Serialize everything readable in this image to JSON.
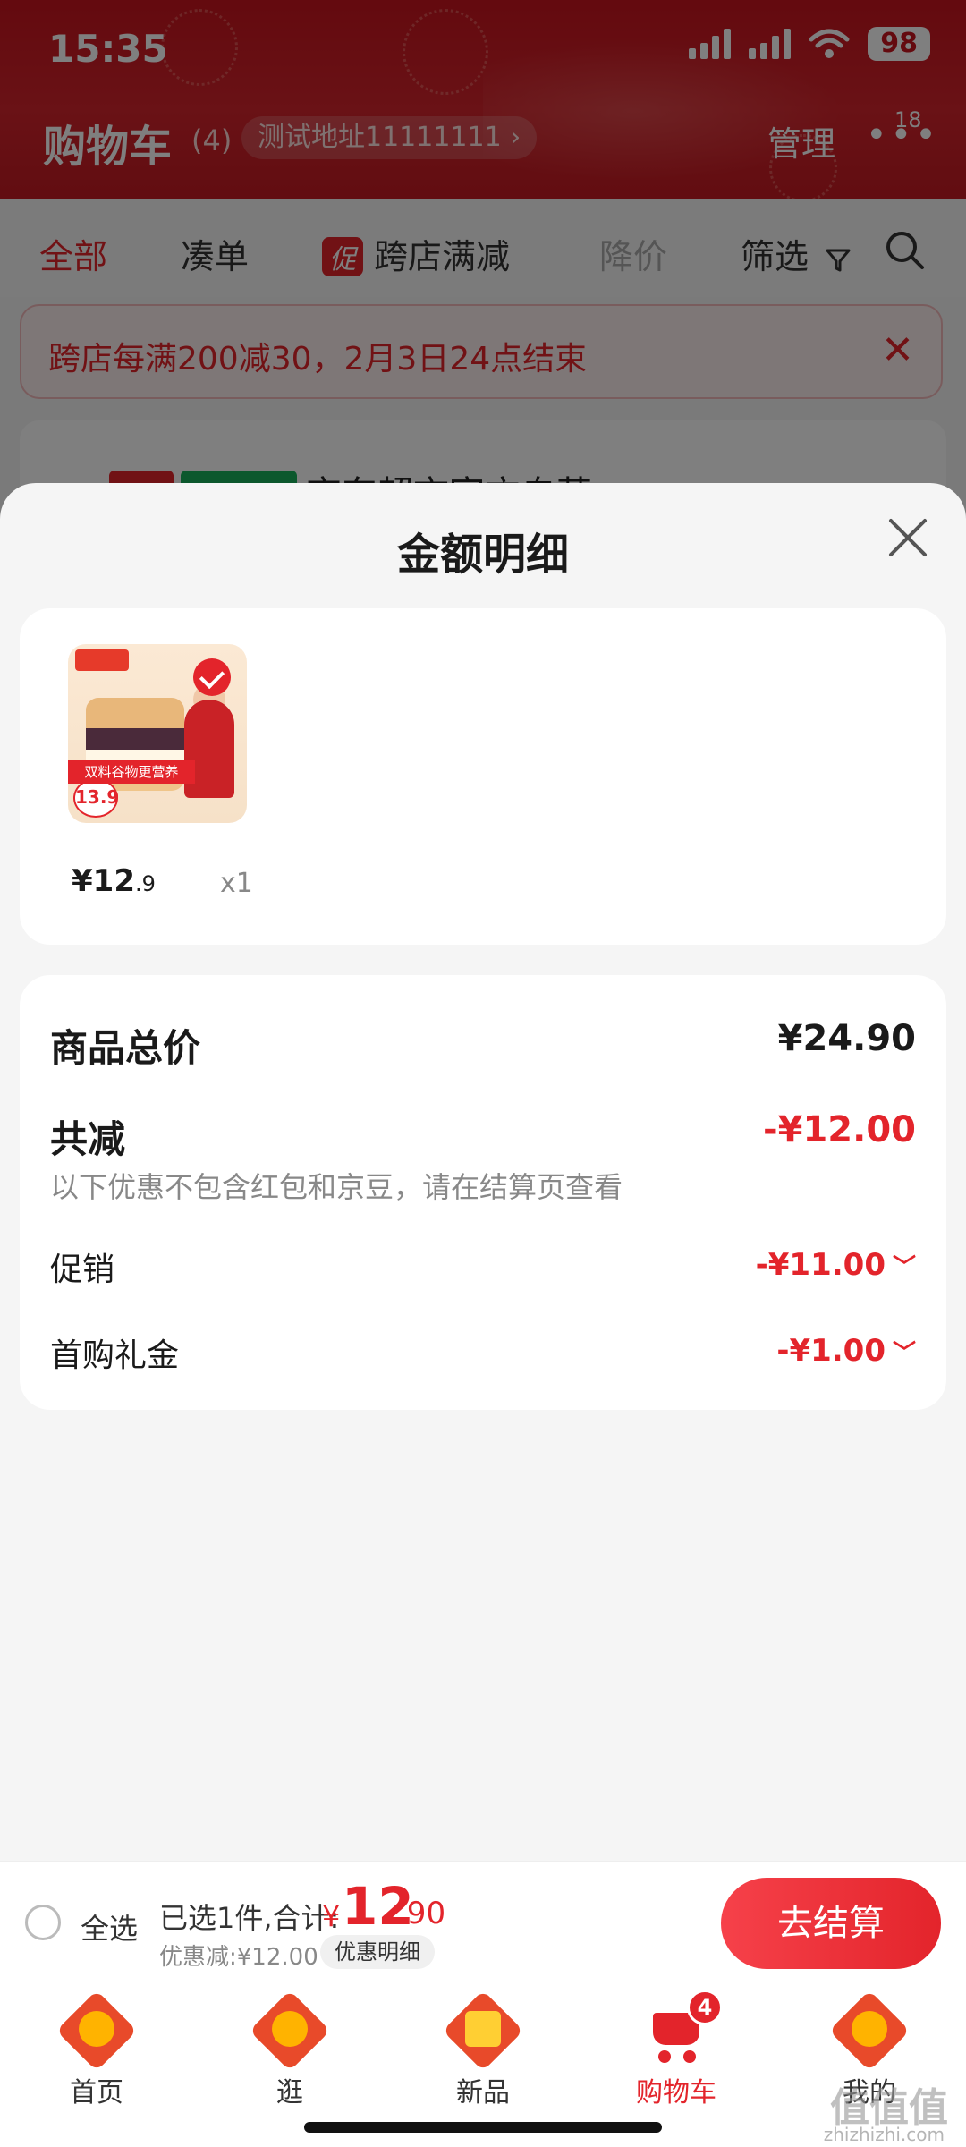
{
  "status_bar": {
    "time": "15:35",
    "battery": "98"
  },
  "header": {
    "title": "购物车",
    "count": "(4)",
    "address": "测试地址11111111 ›",
    "manage": "管理",
    "more": "•••",
    "message_badge": "18"
  },
  "filter_tabs": [
    {
      "label": "全部",
      "active": true
    },
    {
      "label": "凑单"
    },
    {
      "label": "跨店满减",
      "tag": "促"
    },
    {
      "label": "降价"
    },
    {
      "label": "筛选"
    }
  ],
  "notice": {
    "text": "跨店每满200减30，2月3日24点结束",
    "close": "✕"
  },
  "store_row": {
    "text": "京东超市官方自营 ›"
  },
  "sheet": {
    "title": "金额明细",
    "product": {
      "price_int": "¥12",
      "price_dec": ".9",
      "quantity": "x1",
      "thumb_badge": "13.9",
      "thumb_banner": "双料谷物更营养"
    },
    "summary": {
      "total_label": "商品总价",
      "total_value": "¥24.90",
      "discount_label": "共减",
      "discount_value": "-¥12.00",
      "discount_note": "以下优惠不包含红包和京豆，请在结算页查看",
      "items": [
        {
          "label": "促销",
          "value": "-¥11.00"
        },
        {
          "label": "首购礼金",
          "value": "-¥1.00"
        }
      ]
    }
  },
  "checkout": {
    "select_all": "全选",
    "selected_info": "已选1件,合计:",
    "currency": "¥",
    "total_int": "12",
    "total_dec": ".90",
    "discount_text": "优惠减:¥12.00",
    "discount_detail": "优惠明细",
    "pay_button": "去结算"
  },
  "nav": [
    {
      "label": "首页",
      "icon": "home-icon"
    },
    {
      "label": "逛",
      "icon": "browse-icon"
    },
    {
      "label": "新品",
      "icon": "new-products-icon"
    },
    {
      "label": "购物车",
      "icon": "cart-icon",
      "badge": "4",
      "active": true
    },
    {
      "label": "我的",
      "icon": "profile-icon"
    }
  ],
  "watermark": {
    "main": "值值值",
    "sub": "zhizhizhi.com"
  },
  "colors": {
    "brand_red": "#e3242b",
    "header_red": "#c8141e"
  }
}
